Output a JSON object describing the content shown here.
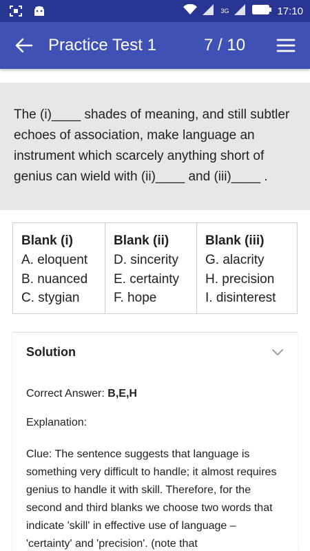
{
  "status_bar": {
    "time": "17:10",
    "net_label": "3G",
    "colors": {
      "background": "#283593"
    }
  },
  "app_bar": {
    "title": "Practice Test 1",
    "question_current": "7",
    "question_total": "/ 10",
    "icons": {
      "back": "back-arrow-icon",
      "menu": "hamburger-menu-icon"
    },
    "colors": {
      "background": "#3f51b5"
    }
  },
  "question": {
    "text": "The (i)____ shades of meaning, and still subtler echoes of association, make language an instrument which scarcely anything short of genius can wield with (ii)____ and (iii)____ .",
    "colors": {
      "background": "#e7e7e7"
    }
  },
  "blanks": [
    {
      "heading": "Blank (i)",
      "options": [
        "A. eloquent",
        "B. nuanced",
        "C. stygian"
      ]
    },
    {
      "heading": "Blank (ii)",
      "options": [
        "D. sincerity",
        "E. certainty",
        "F. hope"
      ]
    },
    {
      "heading": "Blank (iii)",
      "options": [
        "G. alacrity",
        "H. precision",
        "I. disinterest"
      ]
    }
  ],
  "solution": {
    "title": "Solution",
    "correct_answer_label": "Correct Answer:",
    "correct_answer_value": "B,E,H",
    "explanation_label": "Explanation:",
    "explanation_text": "Clue: The sentence suggests that language is something very difficult to handle; it almost requires genius to handle it with skill. Therefore, for the second and third blanks we choose two words that indicate 'skill' in effective use of language – 'certainty' and 'precision'. (note that",
    "icons": {
      "toggle": "chevron-down-icon"
    }
  }
}
